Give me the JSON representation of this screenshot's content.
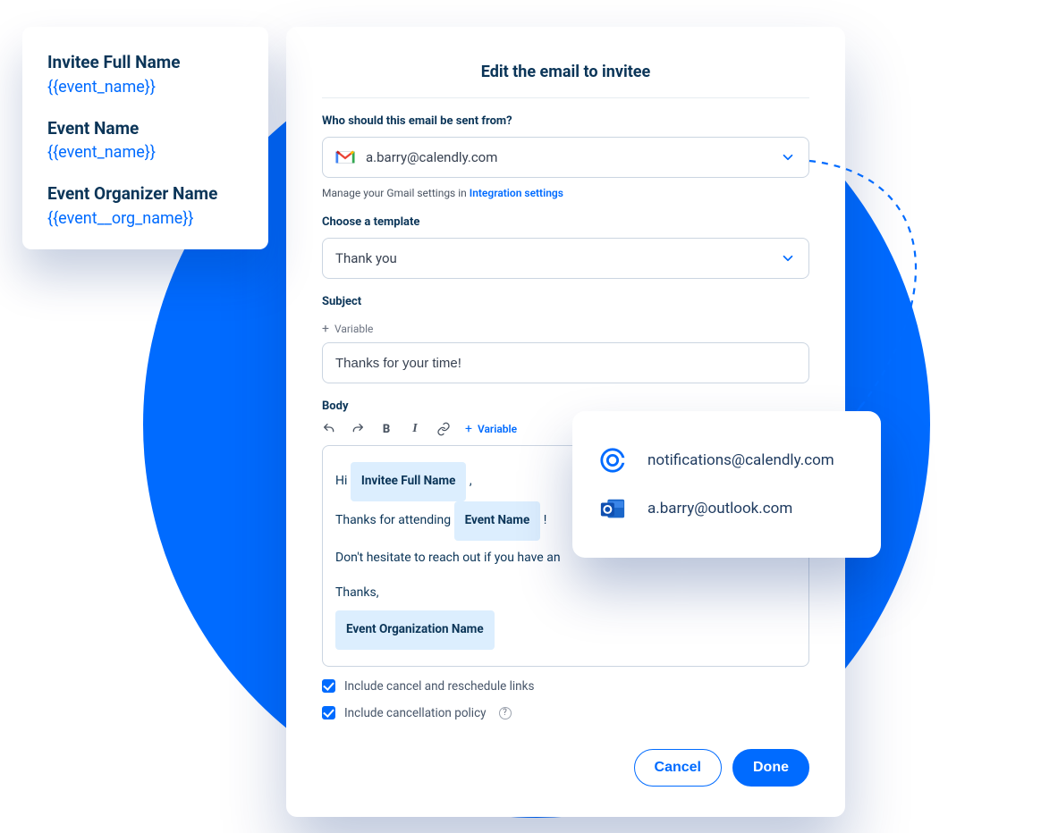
{
  "legend": {
    "items": [
      {
        "title": "Invitee Full Name",
        "token": "{{event_name}}"
      },
      {
        "title": "Event Name",
        "token": "{{event_name}}"
      },
      {
        "title": "Event Organizer Name",
        "token": "{{event__org_name}}"
      }
    ]
  },
  "dialog": {
    "title": "Edit the email to invitee",
    "sender_label": "Who should this email be sent from?",
    "sender_value": "a.barry@calendly.com",
    "hint_prefix": "Manage your Gmail settings in ",
    "hint_link": "Integration settings",
    "template_label": "Choose a template",
    "template_value": "Thank you",
    "subject_label": "Subject",
    "variable_btn": "Variable",
    "subject_value": "Thanks for your time!",
    "body_label": "Body",
    "body": {
      "greeting_prefix": "Hi ",
      "chip_invitee": "Invitee Full Name",
      "greeting_suffix": " ,",
      "line2_prefix": "Thanks for attending ",
      "chip_event": "Event Name",
      "line2_suffix": " !",
      "line3": "Don't hesitate to reach out if you have an",
      "signoff": "Thanks,",
      "chip_org": "Event Organization Name"
    },
    "cb1": "Include cancel and reschedule links",
    "cb2": "Include cancellation policy",
    "cancel": "Cancel",
    "done": "Done"
  },
  "popover": {
    "opt1": "notifications@calendly.com",
    "opt2": "a.barry@outlook.com"
  }
}
